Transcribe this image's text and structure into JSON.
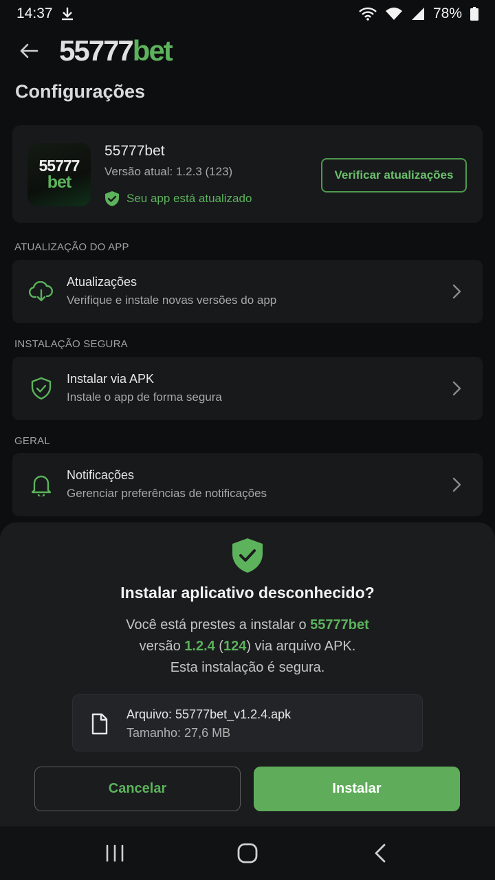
{
  "status_bar": {
    "time": "14:37",
    "battery": "78%",
    "icons": [
      "download-icon",
      "wifi-icon",
      "wifi-calling-icon",
      "signal-icon",
      "battery-icon"
    ]
  },
  "header": {
    "brand_num": "55777",
    "brand_bet": "bet",
    "back_icon": "arrow-left-icon"
  },
  "page": {
    "title": "Configurações"
  },
  "app_card": {
    "logo_line1": "55777",
    "logo_line2": "bet",
    "name": "55777bet",
    "version": "Versão atual: 1.2.3 (123)",
    "status": "Seu app está atualizado",
    "check_button": "Verificar atualizações"
  },
  "sections": {
    "app_update": "ATUALIZAÇÃO DO APP",
    "secure_install": "INSTALAÇÃO SEGURA",
    "general": "GERAL"
  },
  "menu": {
    "updates": {
      "title": "Atualizações",
      "subtitle": "Verifique e instale novas versões do app",
      "icon": "cloud-download-icon"
    },
    "apk": {
      "title": "Instalar via APK",
      "subtitle": "Instale o app de forma segura",
      "icon": "shield-check-icon"
    },
    "notifications": {
      "title": "Notificações",
      "subtitle": "Gerenciar preferências de notificações",
      "icon": "bell-icon"
    }
  },
  "dialog": {
    "title": "Instalar aplicativo desconhecido?",
    "line1_prefix": "Você está prestes a instalar o ",
    "app_name": "55777bet",
    "line2_prefix": "versão ",
    "version": "1.2.4",
    "open_paren": " (",
    "build": "124",
    "line2_suffix": ") via arquivo APK.",
    "line3": "Esta instalação é segura.",
    "file_name": "Arquivo: 55777bet_v1.2.4.apk",
    "file_size": "Tamanho: 27,6 MB",
    "cancel": "Cancelar",
    "install": "Instalar"
  },
  "colors": {
    "accent": "#5cb35c",
    "background": "#0d0e10",
    "card": "#17191b",
    "sheet": "#1b1c1e"
  }
}
